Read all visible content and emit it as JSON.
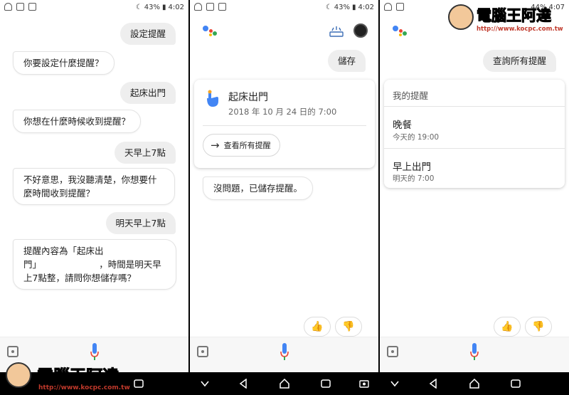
{
  "status": {
    "left_battery": "43%",
    "left_time": "4:02",
    "mid_battery": "43%",
    "mid_time": "4:02",
    "right_battery": "44%",
    "right_time": "4:07"
  },
  "panel1": {
    "messages": [
      {
        "role": "user",
        "text": "設定提醒"
      },
      {
        "role": "bot",
        "text": "你要設定什麼提醒？"
      },
      {
        "role": "user",
        "text": "起床出門"
      },
      {
        "role": "bot",
        "text": "你想在什麼時候收到提醒？"
      },
      {
        "role": "user",
        "text": "天早上7點"
      },
      {
        "role": "bot",
        "text": "不好意思，我沒聽清楚，你想要什麼時間收到提醒？"
      },
      {
        "role": "user",
        "text": "明天早上7點"
      },
      {
        "role": "bot",
        "text": "提醒內容為「起床出門」　　　　　　　，時間是明天早上7點整，請問你想儲存嗎？"
      }
    ]
  },
  "panel2": {
    "user_message": "儲存",
    "card": {
      "title": "起床出門",
      "subtitle": "2018 年 10 月 24 日的 7:00",
      "chip_label": "查看所有提醒"
    },
    "bot_message": "沒問題，已儲存提醒。"
  },
  "panel3": {
    "user_message": "查詢所有提醒",
    "list": {
      "header": "我的提醒",
      "items": [
        {
          "title": "晚餐",
          "time": "今天的 19:00"
        },
        {
          "title": "早上出門",
          "time": "明天的 7:00"
        }
      ]
    }
  },
  "watermark": {
    "title": "電腦王阿達",
    "url": "http://www.kocpc.com.tw"
  },
  "colors": {
    "google_blue": "#4285F4",
    "google_red": "#EA4335",
    "google_yellow": "#FBBC05",
    "google_green": "#34A853",
    "thumb": "#F5A623"
  }
}
